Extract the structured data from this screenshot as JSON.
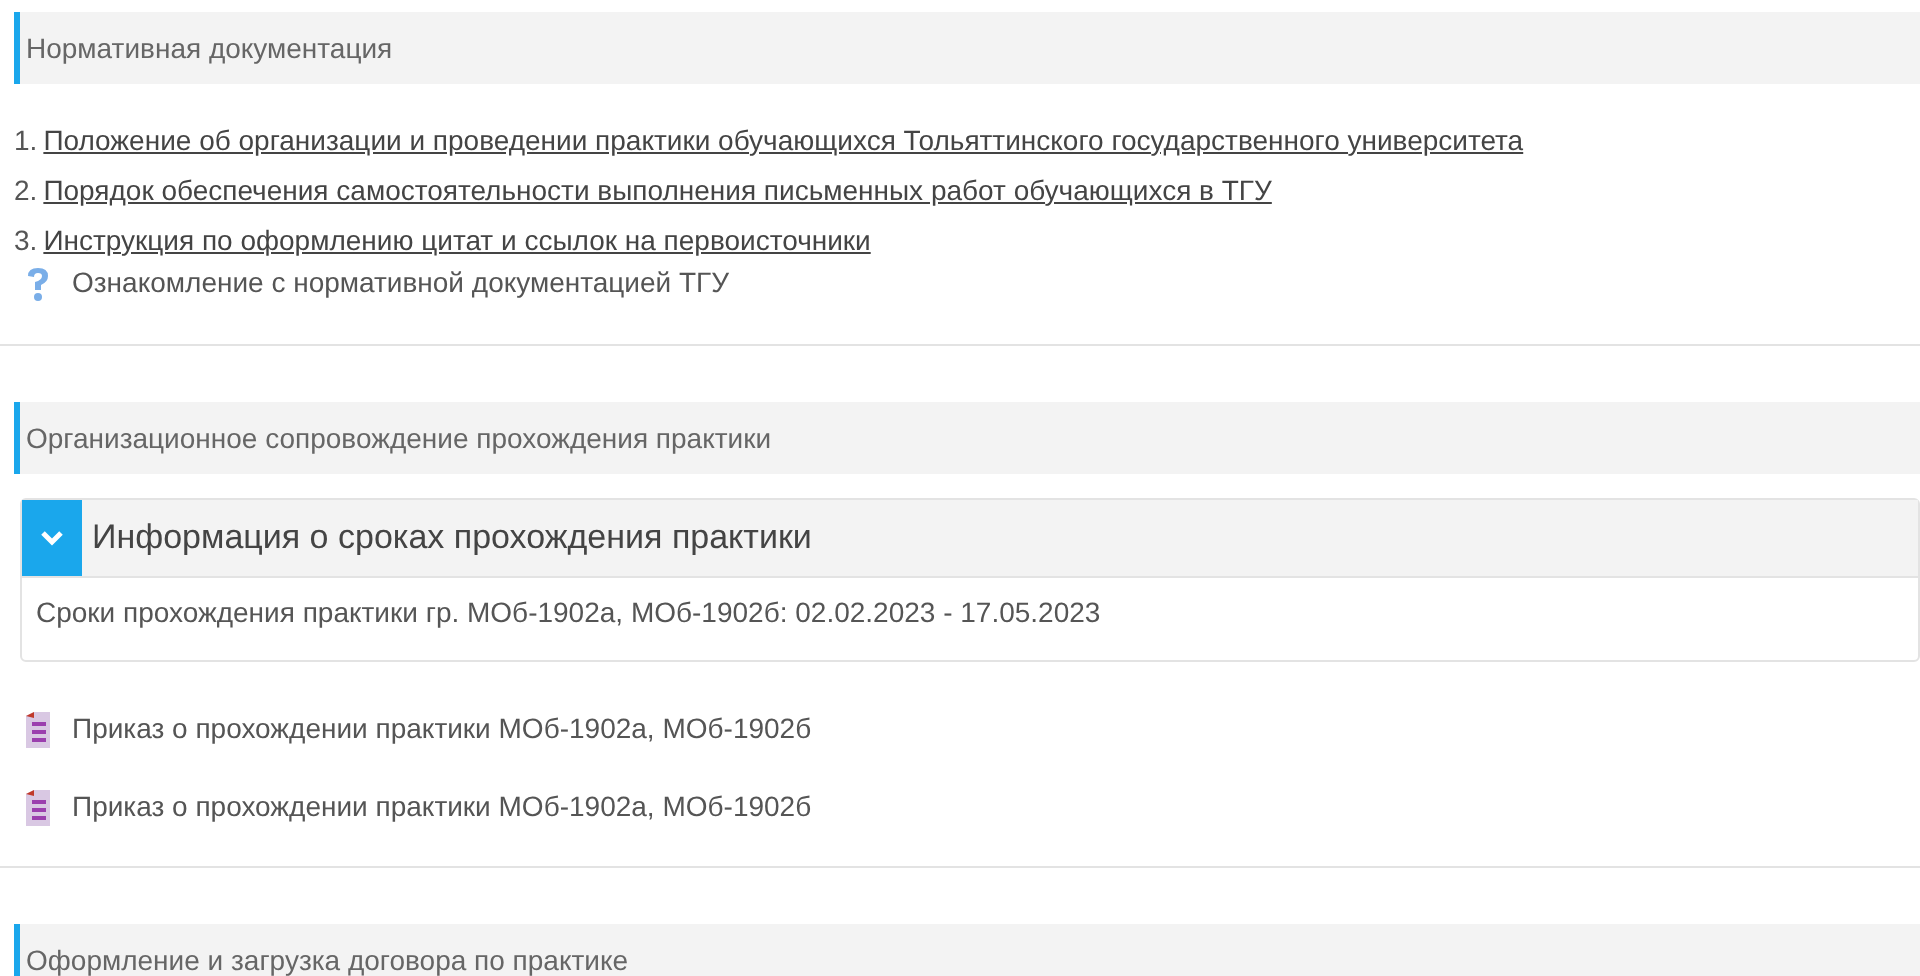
{
  "sections": [
    {
      "title": "Нормативная документация",
      "blocks": [
        {
          "kind": "numbered_links",
          "items": [
            {
              "number": "1.",
              "text": "Положение об организации и проведении практики обучающихся Тольяттинского государственного университета"
            },
            {
              "number": "2.",
              "text": "Порядок обеспечения самостоятельности выполнения письменных работ обучающихся в ТГУ"
            },
            {
              "number": "3.",
              "text": "Инструкция по оформлению цитат и ссылок на первоисточники"
            }
          ]
        },
        {
          "kind": "help",
          "text": "Ознакомление с нормативной документацией ТГУ"
        }
      ]
    },
    {
      "title": "Организационное сопровождение прохождения практики",
      "blocks": [
        {
          "kind": "collapsible",
          "title": "Информация о сроках прохождения практики",
          "expanded": true,
          "body": "Сроки прохождения практики гр. МОб-1902а, МОб-1902б: 02.02.2023 - 17.05.2023"
        },
        {
          "kind": "document",
          "text": "Приказ о прохождении практики МОб-1902а, МОб-1902б"
        },
        {
          "kind": "document",
          "text": "Приказ о прохождении практики МОб-1902а, МОб-1902б"
        }
      ]
    },
    {
      "title": "Оформление и загрузка договора по практике"
    }
  ]
}
